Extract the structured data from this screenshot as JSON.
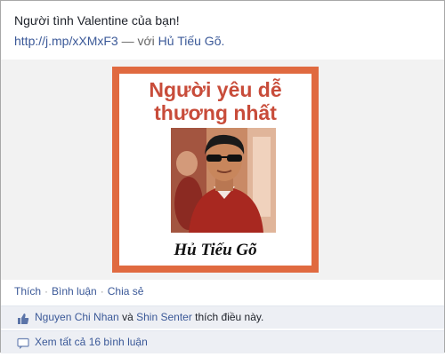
{
  "post": {
    "message": "Người tình Valentine của bạn!",
    "link_text": "http://j.mp/xXMxF3",
    "dash": "—",
    "with_word": "với",
    "tagged_friend": "Hủ Tiếu Gõ."
  },
  "attachment": {
    "title_line1": "Người yêu dễ",
    "title_line2": "thương nhất",
    "name": "Hủ Tiếu Gõ",
    "frame_color": "#e06a40",
    "title_color": "#c84c3a"
  },
  "actions": {
    "like": "Thích",
    "comment": "Bình luận",
    "share": "Chia sẻ",
    "separator": "·"
  },
  "likes": {
    "icon": "thumbs-up-icon",
    "user1": "Nguyen Chi Nhan",
    "and_word": "và",
    "user2": "Shin Senter",
    "suffix": "thích điều này."
  },
  "comments": {
    "icon": "comment-bubble-icon",
    "view_all": "Xem tất cả 16 bình luận"
  }
}
